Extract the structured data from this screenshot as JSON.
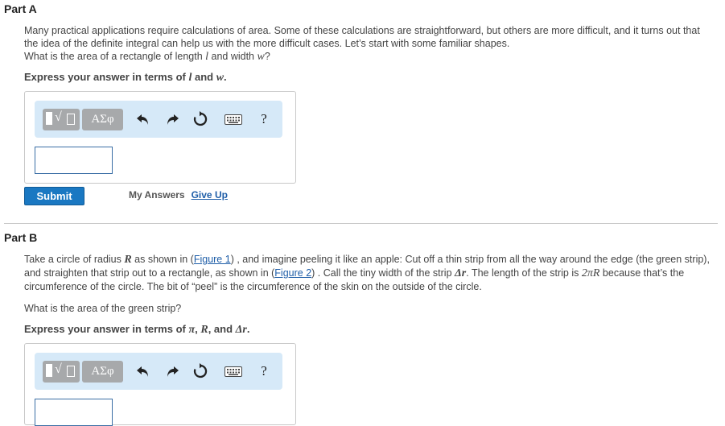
{
  "partA": {
    "title": "Part A",
    "para1": "Many practical applications require calculations of area. Some of these calculations are straightforward, but others are more difficult, and it turns out that the idea of the definite integral can help us with the more difficult cases. Let’s start with some familiar shapes.",
    "q_pre": "What is the area of a rectangle of length ",
    "var_l": "l",
    "q_mid": " and width ",
    "var_w": "w",
    "q_post": "?",
    "express_pre": "Express your answer in terms of ",
    "express_l": "l",
    "express_and": " and ",
    "express_w": "w",
    "express_end": ".",
    "submit": "Submit",
    "my_answers": "My Answers",
    "give_up": "Give Up"
  },
  "partB": {
    "title": "Part B",
    "p1": "Take a circle of radius ",
    "R": "R",
    "p2": " as shown in (",
    "fig1": "Figure 1",
    "p3": ") , and imagine peeling it like an apple: Cut off a thin strip from all the way around the edge (the green strip), and straighten that strip out to a rectangle, as shown in (",
    "fig2": "Figure 2",
    "p4": ") . Call the tiny width of the strip ",
    "dr": "Δr",
    "p5": ". The length of the strip is ",
    "twopiR": "2πR",
    "p6": " because that’s the circumference of the circle. The bit of “peel” is the circumference of the skin on the outside of the circle.",
    "question": "What is the area of the green strip?",
    "express_pre": "Express your answer in terms of ",
    "express_pi": "π",
    "express_sep1": ", ",
    "express_R": "R",
    "express_sep2": ", and ",
    "express_dr": "Δr",
    "express_end": "."
  },
  "toolbar": {
    "template_icon": "▮√▯",
    "greek_label": "ΑΣφ",
    "help": "?",
    "icons": [
      "undo-icon",
      "redo-icon",
      "reset-icon",
      "keyboard-icon",
      "help-icon"
    ]
  },
  "colors": {
    "link": "#1f5ea8",
    "submit": "#1a78c2",
    "toolbar_bg": "#d6e9f8",
    "tool_btn": "#a7a9ab"
  }
}
